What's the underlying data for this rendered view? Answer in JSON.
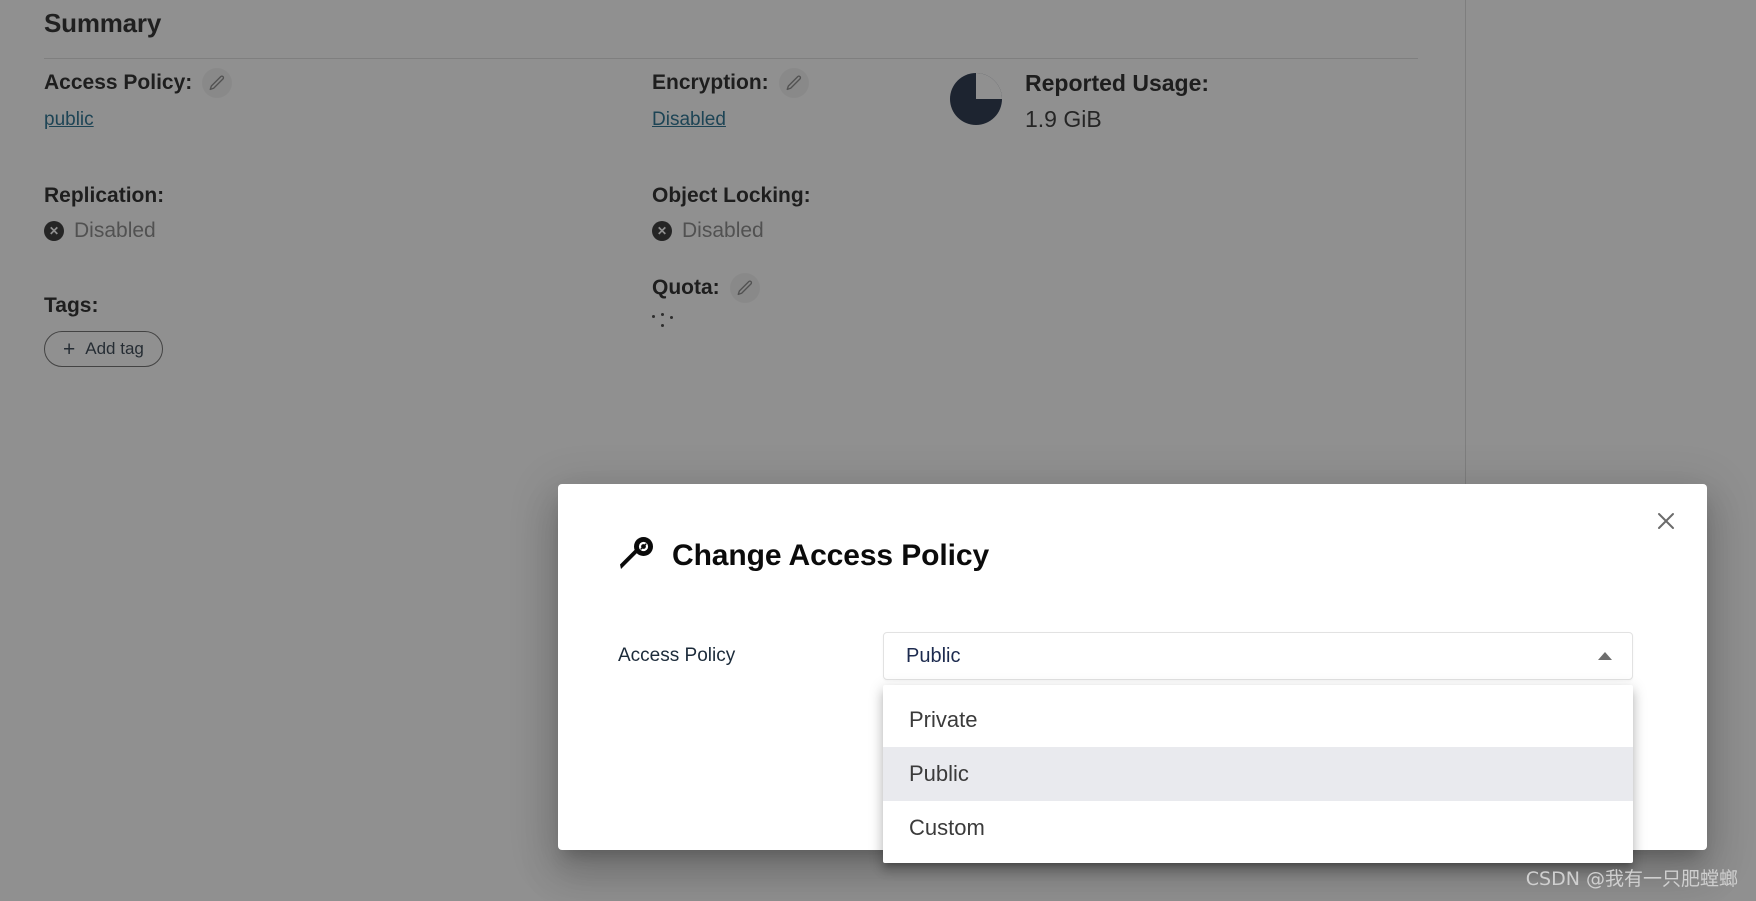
{
  "summary": {
    "title": "Summary",
    "access_policy": {
      "label": "Access Policy:",
      "value": "public",
      "edit_icon": "pencil-icon"
    },
    "replication": {
      "label": "Replication:",
      "value": "Disabled",
      "status_icon": "circled-x-icon"
    },
    "tags": {
      "label": "Tags:",
      "add_tag_label": "Add tag",
      "add_icon": "plus-icon"
    },
    "encryption": {
      "label": "Encryption:",
      "value": "Disabled",
      "edit_icon": "pencil-icon"
    },
    "object_locking": {
      "label": "Object Locking:",
      "value": "Disabled",
      "status_icon": "circled-x-icon"
    },
    "quota": {
      "label": "Quota:",
      "value": "",
      "edit_icon": "pencil-icon",
      "state": "loading"
    },
    "reported_usage": {
      "label": "Reported Usage:",
      "value": "1.9 GiB",
      "chart_icon": "pie-chart-icon"
    }
  },
  "modal": {
    "title": "Change Access Policy",
    "title_icon": "key-icon",
    "close_icon": "close-x-icon",
    "form": {
      "field_label": "Access Policy",
      "selected_value": "Public",
      "caret_icon": "chevron-up-icon",
      "options": [
        {
          "label": "Private",
          "selected": false
        },
        {
          "label": "Public",
          "selected": true
        },
        {
          "label": "Custom",
          "selected": false
        }
      ]
    }
  },
  "watermark": {
    "text": "CSDN @我有一只肥螳螂"
  },
  "colors": {
    "link": "#0b5e82",
    "pie_dark": "#0b1a33",
    "overlay": "#2e2e2e",
    "selected_option_bg": "#e9eaee",
    "select_value_text": "#1d2b4f"
  }
}
